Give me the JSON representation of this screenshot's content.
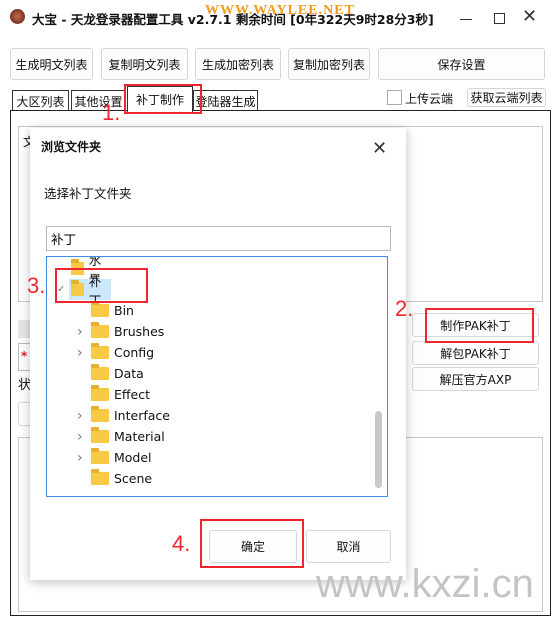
{
  "window": {
    "title": "大宝 - 天龙登录器配置工具 v2.7.1 剩余时间 [0年322天9时28分3秒]",
    "watermark_top": "WWW.WAYLEE.NET",
    "watermark_bottom": "www.kxzi.cn"
  },
  "toolbar": {
    "buttons": [
      "生成明文列表",
      "复制明文列表",
      "生成加密列表",
      "复制加密列表",
      "保存设置"
    ]
  },
  "tabs": [
    "大区列表",
    "其他设置",
    "补丁制作",
    "登陆器生成"
  ],
  "active_tab": "补丁制作",
  "cloud": {
    "upload_label": "上传云端",
    "upload_checked": false,
    "fetch_label": "获取云端列表"
  },
  "patch_panel": {
    "partial_label": "文",
    "status_partial": "状",
    "buttons": [
      "制作PAK补丁",
      "解包PAK补丁",
      "解压官方AXP"
    ]
  },
  "dialog": {
    "title": "浏览文件夹",
    "prompt": "选择补丁文件夹",
    "folder_value": "补丁",
    "tree": [
      {
        "label": "水墨",
        "level": 0,
        "expandable": false
      },
      {
        "label": "补丁",
        "level": 0,
        "expanded": true,
        "selected": true
      },
      {
        "label": "Bin",
        "level": 1,
        "expandable": false
      },
      {
        "label": "Brushes",
        "level": 1,
        "expandable": true
      },
      {
        "label": "Config",
        "level": 1,
        "expandable": true
      },
      {
        "label": "Data",
        "level": 1,
        "expandable": false
      },
      {
        "label": "Effect",
        "level": 1,
        "expandable": false
      },
      {
        "label": "Interface",
        "level": 1,
        "expandable": true
      },
      {
        "label": "Material",
        "level": 1,
        "expandable": true
      },
      {
        "label": "Model",
        "level": 1,
        "expandable": true
      },
      {
        "label": "Scene",
        "level": 1,
        "expandable": false
      }
    ],
    "ok_label": "确定",
    "cancel_label": "取消"
  },
  "annotations": [
    "1.",
    "2.",
    "3.",
    "4."
  ],
  "colors": {
    "annotation": "#f0262e",
    "selection": "#cce8ff",
    "folder": "#f7c945"
  }
}
